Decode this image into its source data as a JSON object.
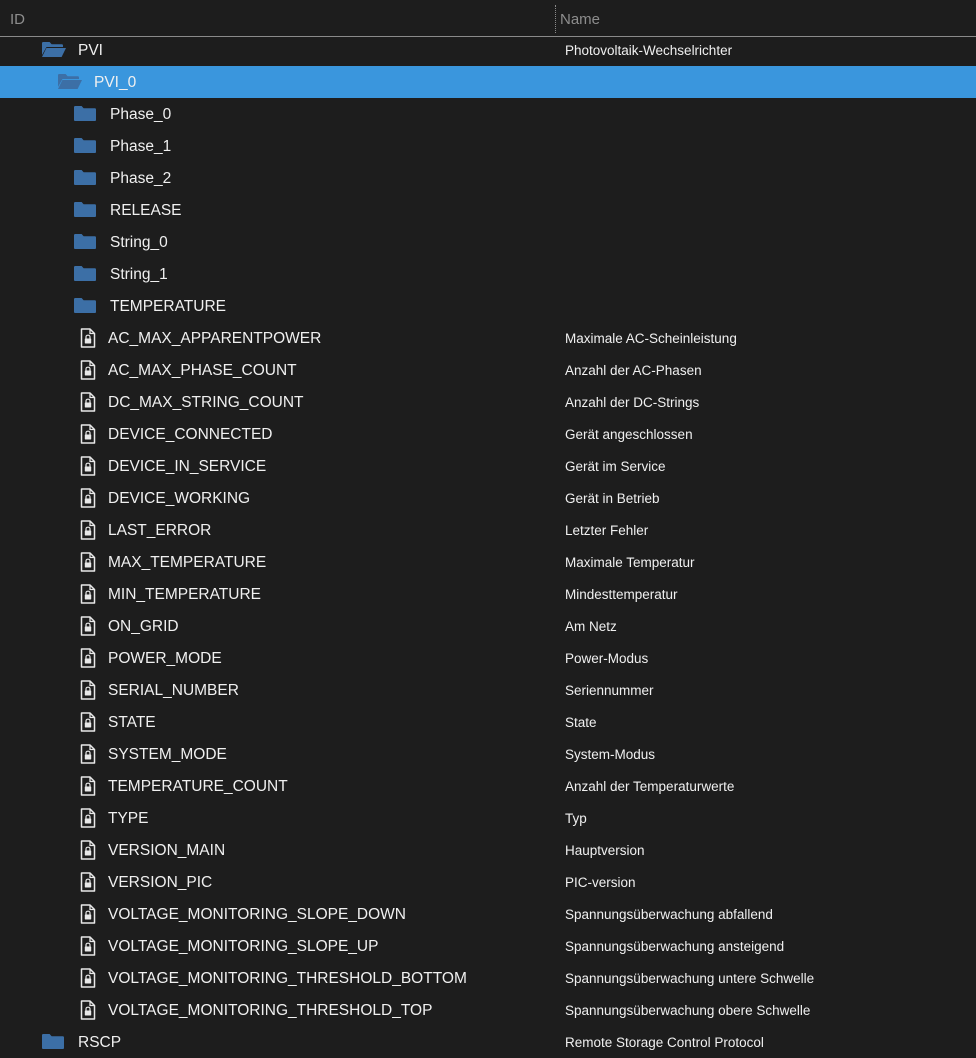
{
  "header": {
    "id_label": "ID",
    "name_label": "Name"
  },
  "colors": {
    "background": "#1d1d1d",
    "selection": "#3a96dd",
    "folder": "#3c6fa6",
    "text": "#f0f0f0",
    "header_text": "#8d8d8d"
  },
  "rows": [
    {
      "id": "PVI",
      "name": "Photovoltaik-Wechselrichter",
      "level": 0,
      "type": "folder-open",
      "selected": false
    },
    {
      "id": "PVI_0",
      "name": "",
      "level": 1,
      "type": "folder-open",
      "selected": true
    },
    {
      "id": "Phase_0",
      "name": "",
      "level": 2,
      "type": "folder",
      "selected": false
    },
    {
      "id": "Phase_1",
      "name": "",
      "level": 2,
      "type": "folder",
      "selected": false
    },
    {
      "id": "Phase_2",
      "name": "",
      "level": 2,
      "type": "folder",
      "selected": false
    },
    {
      "id": "RELEASE",
      "name": "",
      "level": 2,
      "type": "folder",
      "selected": false
    },
    {
      "id": "String_0",
      "name": "",
      "level": 2,
      "type": "folder",
      "selected": false
    },
    {
      "id": "String_1",
      "name": "",
      "level": 2,
      "type": "folder",
      "selected": false
    },
    {
      "id": "TEMPERATURE",
      "name": "",
      "level": 2,
      "type": "folder",
      "selected": false
    },
    {
      "id": "AC_MAX_APPARENTPOWER",
      "name": "Maximale AC-Scheinleistung",
      "level": 2,
      "type": "file-locked",
      "selected": false
    },
    {
      "id": "AC_MAX_PHASE_COUNT",
      "name": "Anzahl der AC-Phasen",
      "level": 2,
      "type": "file-locked",
      "selected": false
    },
    {
      "id": "DC_MAX_STRING_COUNT",
      "name": "Anzahl der DC-Strings",
      "level": 2,
      "type": "file-locked",
      "selected": false
    },
    {
      "id": "DEVICE_CONNECTED",
      "name": "Gerät angeschlossen",
      "level": 2,
      "type": "file-locked",
      "selected": false
    },
    {
      "id": "DEVICE_IN_SERVICE",
      "name": "Gerät im Service",
      "level": 2,
      "type": "file-locked",
      "selected": false
    },
    {
      "id": "DEVICE_WORKING",
      "name": "Gerät in Betrieb",
      "level": 2,
      "type": "file-locked",
      "selected": false
    },
    {
      "id": "LAST_ERROR",
      "name": "Letzter Fehler",
      "level": 2,
      "type": "file-locked",
      "selected": false
    },
    {
      "id": "MAX_TEMPERATURE",
      "name": "Maximale Temperatur",
      "level": 2,
      "type": "file-locked",
      "selected": false
    },
    {
      "id": "MIN_TEMPERATURE",
      "name": "Mindesttemperatur",
      "level": 2,
      "type": "file-locked",
      "selected": false
    },
    {
      "id": "ON_GRID",
      "name": "Am Netz",
      "level": 2,
      "type": "file-locked",
      "selected": false
    },
    {
      "id": "POWER_MODE",
      "name": "Power-Modus",
      "level": 2,
      "type": "file-locked",
      "selected": false
    },
    {
      "id": "SERIAL_NUMBER",
      "name": "Seriennummer",
      "level": 2,
      "type": "file-locked",
      "selected": false
    },
    {
      "id": "STATE",
      "name": "State",
      "level": 2,
      "type": "file-locked",
      "selected": false
    },
    {
      "id": "SYSTEM_MODE",
      "name": "System-Modus",
      "level": 2,
      "type": "file-locked",
      "selected": false
    },
    {
      "id": "TEMPERATURE_COUNT",
      "name": "Anzahl der Temperaturwerte",
      "level": 2,
      "type": "file-locked",
      "selected": false
    },
    {
      "id": "TYPE",
      "name": "Typ",
      "level": 2,
      "type": "file-locked",
      "selected": false
    },
    {
      "id": "VERSION_MAIN",
      "name": "Hauptversion",
      "level": 2,
      "type": "file-locked",
      "selected": false
    },
    {
      "id": "VERSION_PIC",
      "name": "PIC-version",
      "level": 2,
      "type": "file-locked",
      "selected": false
    },
    {
      "id": "VOLTAGE_MONITORING_SLOPE_DOWN",
      "name": "Spannungsüberwachung abfallend",
      "level": 2,
      "type": "file-locked",
      "selected": false
    },
    {
      "id": "VOLTAGE_MONITORING_SLOPE_UP",
      "name": "Spannungsüberwachung ansteigend",
      "level": 2,
      "type": "file-locked",
      "selected": false
    },
    {
      "id": "VOLTAGE_MONITORING_THRESHOLD_BOTTOM",
      "name": "Spannungsüberwachung untere Schwelle",
      "level": 2,
      "type": "file-locked",
      "selected": false
    },
    {
      "id": "VOLTAGE_MONITORING_THRESHOLD_TOP",
      "name": "Spannungsüberwachung obere Schwelle",
      "level": 2,
      "type": "file-locked",
      "selected": false
    },
    {
      "id": "RSCP",
      "name": "Remote Storage Control Protocol",
      "level": 0,
      "type": "folder",
      "selected": false
    }
  ]
}
